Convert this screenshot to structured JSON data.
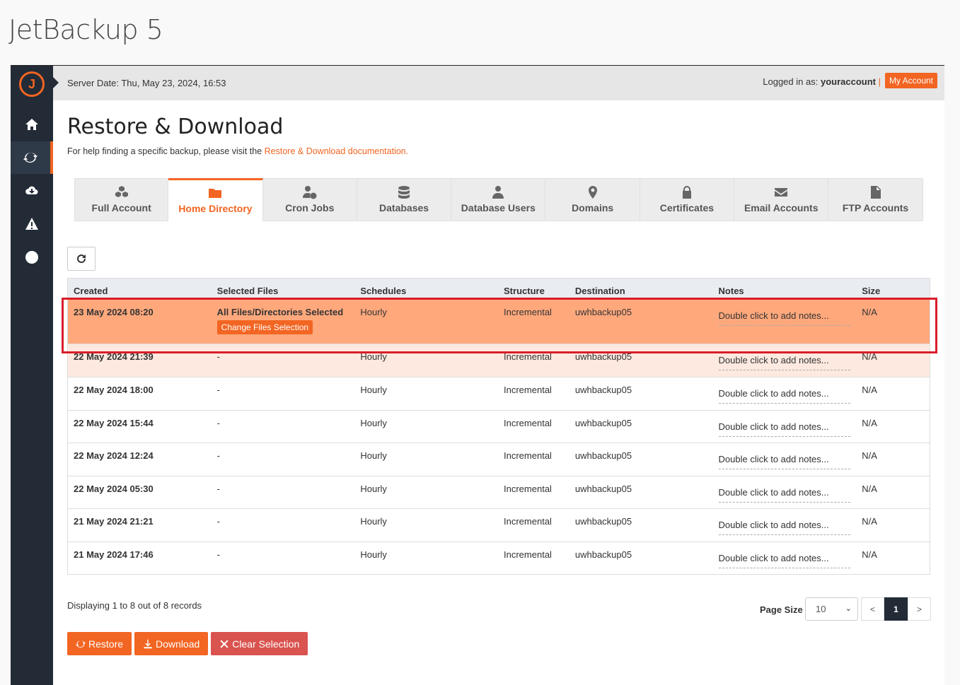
{
  "app_title": "JetBackup 5",
  "topbar": {
    "server_date": "Server Date: Thu, May 23, 2024, 16:53",
    "logged_prefix": "Logged in as:",
    "username": "youraccount",
    "separator": "|",
    "my_account": "My Account"
  },
  "page": {
    "title": "Restore & Download",
    "help_text": "For help finding a specific backup, please visit the",
    "help_link": "Restore & Download documentation."
  },
  "tabs": [
    {
      "label": "Full Account",
      "icon": "cubes-icon"
    },
    {
      "label": "Home Directory",
      "icon": "folder-icon"
    },
    {
      "label": "Cron Jobs",
      "icon": "user-clock-icon"
    },
    {
      "label": "Databases",
      "icon": "database-icon"
    },
    {
      "label": "Database Users",
      "icon": "user-tie-icon"
    },
    {
      "label": "Domains",
      "icon": "map-marker-icon"
    },
    {
      "label": "Certificates",
      "icon": "lock-icon"
    },
    {
      "label": "Email Accounts",
      "icon": "envelope-icon"
    },
    {
      "label": "FTP Accounts",
      "icon": "file-icon"
    }
  ],
  "table": {
    "headers": [
      "Created",
      "Selected Files",
      "Schedules",
      "Structure",
      "Destination",
      "Notes",
      "Size"
    ],
    "rows": [
      {
        "created": "23 May 2024 08:20",
        "files": "All Files/Directories Selected",
        "schedules": "Hourly",
        "structure": "Incremental",
        "destination": "uwhbackup05",
        "notes": "Double click to add notes...",
        "size": "N/A"
      },
      {
        "created": "22 May 2024 21:39",
        "files": "-",
        "schedules": "Hourly",
        "structure": "Incremental",
        "destination": "uwhbackup05",
        "notes": "Double click to add notes...",
        "size": "N/A"
      },
      {
        "created": "22 May 2024 18:00",
        "files": "-",
        "schedules": "Hourly",
        "structure": "Incremental",
        "destination": "uwhbackup05",
        "notes": "Double click to add notes...",
        "size": "N/A"
      },
      {
        "created": "22 May 2024 15:44",
        "files": "-",
        "schedules": "Hourly",
        "structure": "Incremental",
        "destination": "uwhbackup05",
        "notes": "Double click to add notes...",
        "size": "N/A"
      },
      {
        "created": "22 May 2024 12:24",
        "files": "-",
        "schedules": "Hourly",
        "structure": "Incremental",
        "destination": "uwhbackup05",
        "notes": "Double click to add notes...",
        "size": "N/A"
      },
      {
        "created": "22 May 2024 05:30",
        "files": "-",
        "schedules": "Hourly",
        "structure": "Incremental",
        "destination": "uwhbackup05",
        "notes": "Double click to add notes...",
        "size": "N/A"
      },
      {
        "created": "21 May 2024 21:21",
        "files": "-",
        "schedules": "Hourly",
        "structure": "Incremental",
        "destination": "uwhbackup05",
        "notes": "Double click to add notes...",
        "size": "N/A"
      },
      {
        "created": "21 May 2024 17:46",
        "files": "-",
        "schedules": "Hourly",
        "structure": "Incremental",
        "destination": "uwhbackup05",
        "notes": "Double click to add notes...",
        "size": "N/A"
      }
    ],
    "change_files_label": "Change Files Selection"
  },
  "footer": {
    "records": "Displaying 1 to 8 out of 8 records",
    "page_size_label": "Page Size",
    "page_size_value": "10",
    "prev": "<",
    "current_page": "1",
    "next": ">"
  },
  "actions": {
    "restore": "Restore",
    "download": "Download",
    "clear": "Clear Selection"
  },
  "colors": {
    "accent": "#f26522",
    "sidebar": "#232b36",
    "selected_row": "#ffa87c",
    "highlight_row": "#fde9df",
    "outline": "#d91e2a"
  }
}
